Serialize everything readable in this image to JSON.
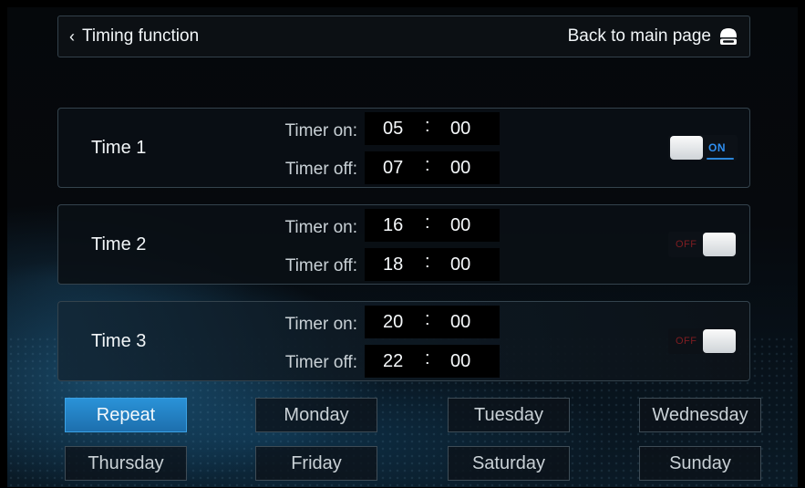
{
  "header": {
    "back_label": "Timing function",
    "main_label": "Back to main page"
  },
  "timers": [
    {
      "title": "Time 1",
      "on_label": "Timer on:",
      "off_label": "Timer off:",
      "on_h": "05",
      "on_m": "00",
      "off_h": "07",
      "off_m": "00",
      "state": "ON",
      "enabled": true
    },
    {
      "title": "Time 2",
      "on_label": "Timer on:",
      "off_label": "Timer off:",
      "on_h": "16",
      "on_m": "00",
      "off_h": "18",
      "off_m": "00",
      "state": "OFF",
      "enabled": false
    },
    {
      "title": "Time 3",
      "on_label": "Timer on:",
      "off_label": "Timer off:",
      "on_h": "20",
      "on_m": "00",
      "off_h": "22",
      "off_m": "00",
      "state": "OFF",
      "enabled": false
    }
  ],
  "time_separator": ":",
  "days": [
    "Repeat",
    "Monday",
    "Tuesday",
    "Wednesday",
    "Thursday",
    "Friday",
    "Saturday",
    "Sunday"
  ],
  "active_day": "Repeat",
  "colors": {
    "accent": "#2a93d8",
    "on_text": "#2f8ff0",
    "off_text": "#7f1d21"
  },
  "icons": {
    "back": "chevron-left-icon",
    "main": "home-icon"
  }
}
